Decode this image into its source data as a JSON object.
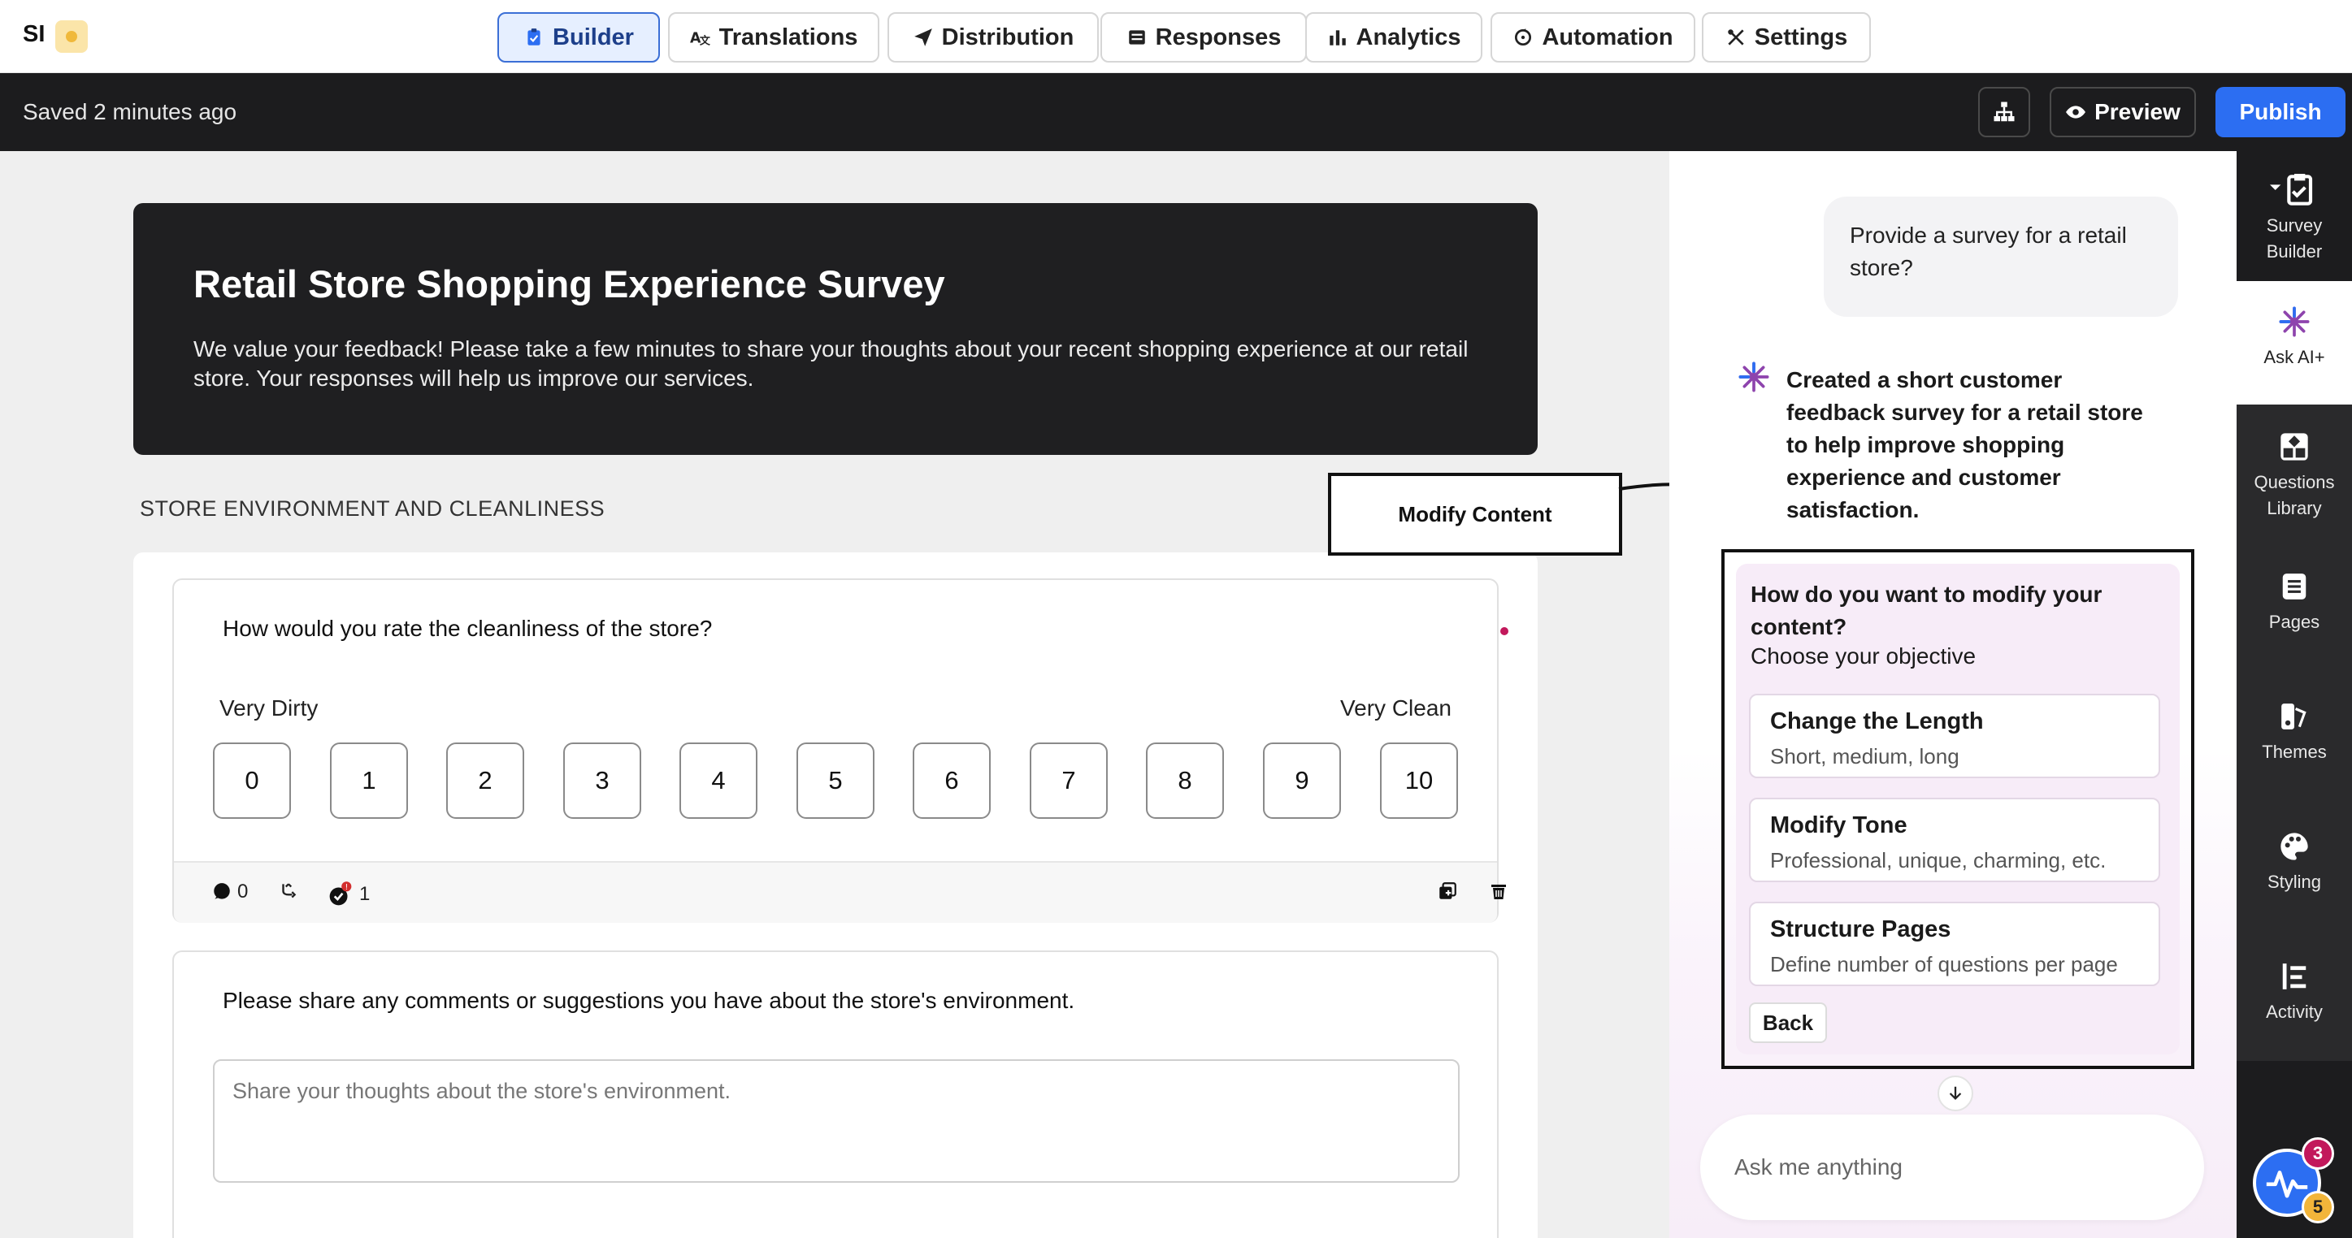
{
  "app": {
    "logo_text": "SI"
  },
  "nav": {
    "tabs": [
      {
        "label": "Builder",
        "icon": "clipboard-icon",
        "active": true
      },
      {
        "label": "Translations",
        "icon": "translate-icon",
        "active": false
      },
      {
        "label": "Distribution",
        "icon": "send-icon",
        "active": false
      },
      {
        "label": "Responses",
        "icon": "list-icon",
        "active": false
      },
      {
        "label": "Analytics",
        "icon": "bar-chart-icon",
        "active": false
      },
      {
        "label": "Automation",
        "icon": "sync-icon",
        "active": false
      },
      {
        "label": "Settings",
        "icon": "tools-icon",
        "active": false
      }
    ]
  },
  "actionbar": {
    "saved_status": "Saved 2 minutes ago",
    "preview_label": "Preview",
    "publish_label": "Publish"
  },
  "survey": {
    "title": "Retail Store Shopping Experience Survey",
    "description": "We value your feedback! Please take a few minutes to share your thoughts about your recent shopping experience at our retail store. Your responses will help us improve our services.",
    "section_title": "STORE ENVIRONMENT AND CLEANLINESS",
    "q1": {
      "text": "How would you rate the cleanliness of the store?",
      "low_label": "Very Dirty",
      "high_label": "Very Clean",
      "scale": [
        "0",
        "1",
        "2",
        "3",
        "4",
        "5",
        "6",
        "7",
        "8",
        "9",
        "10"
      ],
      "comment_count": "0",
      "flag_count": "1"
    },
    "q2": {
      "text": "Please share any comments or suggestions you have about the store's environment.",
      "placeholder": "Share your thoughts about the store's environment."
    }
  },
  "annotation": {
    "callout_label": "Modify Content"
  },
  "chat": {
    "user_message": "Provide a survey for a retail store?",
    "ai_reply": "Created a short customer feedback survey for a retail store to help improve shopping experience and customer satisfaction.",
    "modify_question": "How do you want to modify your content?",
    "modify_sub": "Choose your objective",
    "options": [
      {
        "title": "Change the Length",
        "subtitle": "Short, medium, long"
      },
      {
        "title": "Modify Tone",
        "subtitle": "Professional, unique, charming, etc."
      },
      {
        "title": "Structure Pages",
        "subtitle": "Define number of questions per page"
      }
    ],
    "back_label": "Back",
    "input_placeholder": "Ask me anything"
  },
  "rail": {
    "items": [
      {
        "label": "Survey Builder",
        "icon": "clipboard-check-icon"
      },
      {
        "label": "Ask AI+",
        "icon": "sparkle-icon"
      },
      {
        "label": "Questions Library",
        "icon": "library-icon"
      },
      {
        "label": "Pages",
        "icon": "pages-icon"
      },
      {
        "label": "Themes",
        "icon": "themes-icon"
      },
      {
        "label": "Styling",
        "icon": "palette-icon"
      },
      {
        "label": "Activity",
        "icon": "activity-icon"
      }
    ],
    "badge_red": "3",
    "badge_yellow": "5"
  },
  "colors": {
    "accent": "#2c6ef2",
    "dark": "#1c1c1e",
    "required": "#c2185b",
    "ai_panel": "#f7ecf8"
  }
}
